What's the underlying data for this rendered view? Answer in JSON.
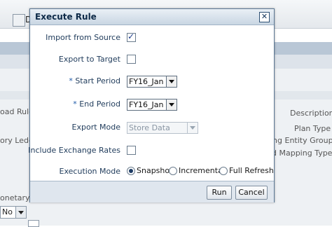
{
  "background": {
    "toolbar_text": "D",
    "labels": {
      "load_rule": "oad Rule",
      "ledger": "ory Ledger",
      "description": "Description",
      "plan_type": "Plan Type",
      "entity_group": "ing Entity Group",
      "mapping_type": "d Mapping Type",
      "monetary": "onetary"
    },
    "select_value": "No"
  },
  "dialog": {
    "title": "Execute Rule",
    "close_glyph": "✕",
    "fields": {
      "import_from_source": {
        "label": "Import from Source",
        "checked": true
      },
      "export_to_target": {
        "label": "Export to Target",
        "checked": false
      },
      "start_period": {
        "required_mark": "*",
        "label": "Start Period",
        "value": "FY16_Jan"
      },
      "end_period": {
        "required_mark": "*",
        "label": "End Period",
        "value": "FY16_Jan"
      },
      "export_mode": {
        "label": "Export Mode",
        "value": "Store Data",
        "disabled": true
      },
      "include_exchange_rates": {
        "label": "Include Exchange Rates",
        "checked": false
      },
      "execution_mode": {
        "label": "Execution Mode",
        "options": [
          "Snapshot",
          "Incremental",
          "Full Refresh"
        ],
        "selected": "Snapshot"
      }
    },
    "buttons": {
      "run": "Run",
      "cancel": "Cancel"
    }
  }
}
